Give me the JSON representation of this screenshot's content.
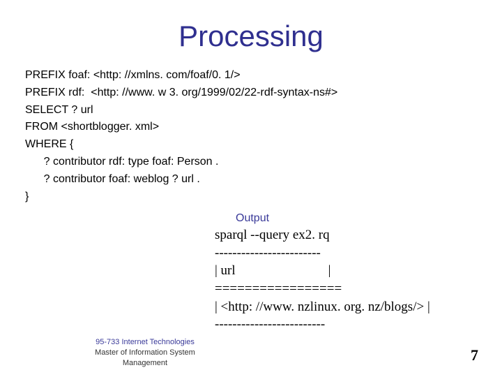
{
  "title": "Processing",
  "query": {
    "line1": "PREFIX foaf: <http: //xmlns. com/foaf/0. 1/>",
    "line2": "PREFIX rdf:  <http: //www. w 3. org/1999/02/22-rdf-syntax-ns#>",
    "line3": "SELECT ? url",
    "line4": "FROM <shortblogger. xml>",
    "line5": "WHERE {",
    "line6": "      ? contributor rdf: type foaf: Person .",
    "line7": "      ? contributor foaf: weblog ? url .",
    "line8": "}"
  },
  "output_label": "Output",
  "output": {
    "line1": "sparql --query ex2. rq",
    "line2": "------------------------",
    "line3": "| url                            |",
    "line4": "=================",
    "line5": "| <http: //www. nzlinux. org. nz/blogs/> |",
    "line6": "-------------------------"
  },
  "footer": {
    "course": "95-733 Internet Technologies",
    "dept1": "Master of Information System",
    "dept2": "Management"
  },
  "page_number": "7"
}
